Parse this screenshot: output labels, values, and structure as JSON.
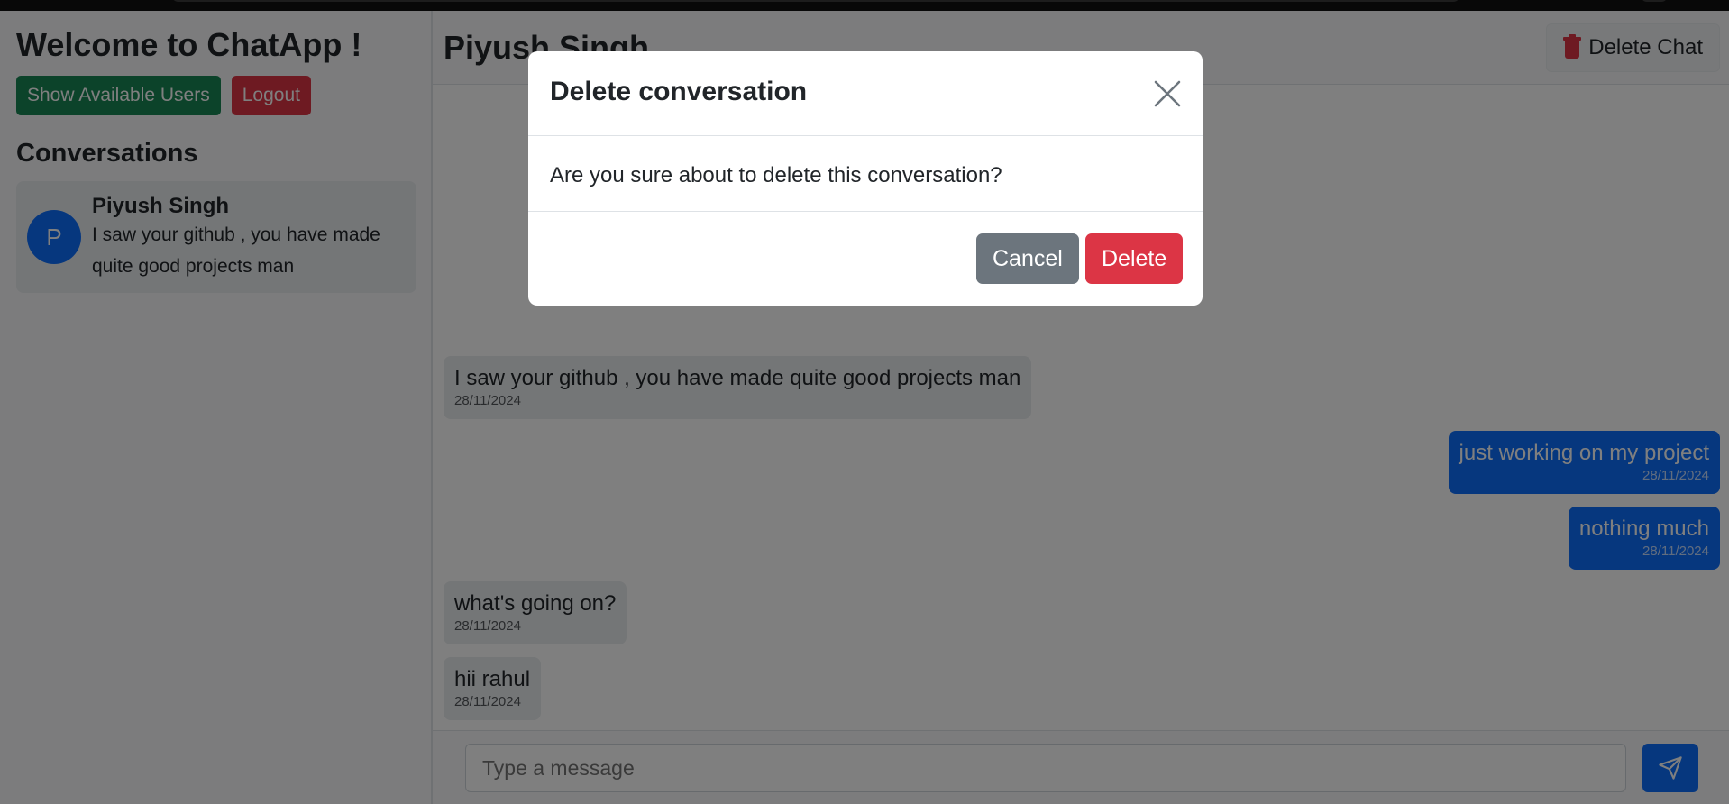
{
  "sidebar": {
    "welcome": "Welcome to ChatApp !",
    "show_users_label": "Show Available Users",
    "logout_label": "Logout",
    "conversations_title": "Conversations",
    "conversations": [
      {
        "avatar_letter": "P",
        "name": "Piyush Singh",
        "preview": "I saw your github , you have made quite good projects man"
      }
    ]
  },
  "chat": {
    "contact_name": "Piyush Singh",
    "delete_chat_label": "Delete Chat",
    "messages": [
      {
        "direction": "received",
        "text": "I saw your github , you have made quite good projects man",
        "date": "28/11/2024"
      },
      {
        "direction": "sent",
        "text": "just working on my project",
        "date": "28/11/2024"
      },
      {
        "direction": "sent",
        "text": "nothing much",
        "date": "28/11/2024"
      },
      {
        "direction": "received",
        "text": "what's going on?",
        "date": "28/11/2024"
      },
      {
        "direction": "received",
        "text": "hii rahul",
        "date": "28/11/2024"
      }
    ],
    "input_placeholder": "Type a message"
  },
  "modal": {
    "title": "Delete conversation",
    "body": "Are you sure about to delete this conversation?",
    "cancel_label": "Cancel",
    "delete_label": "Delete"
  },
  "colors": {
    "primary": "#0d6efd",
    "success": "#198754",
    "danger": "#dc3545",
    "secondary": "#6c757d"
  },
  "icons": {
    "delete_chat": "trash-icon",
    "send": "send-icon",
    "close": "close-icon"
  }
}
